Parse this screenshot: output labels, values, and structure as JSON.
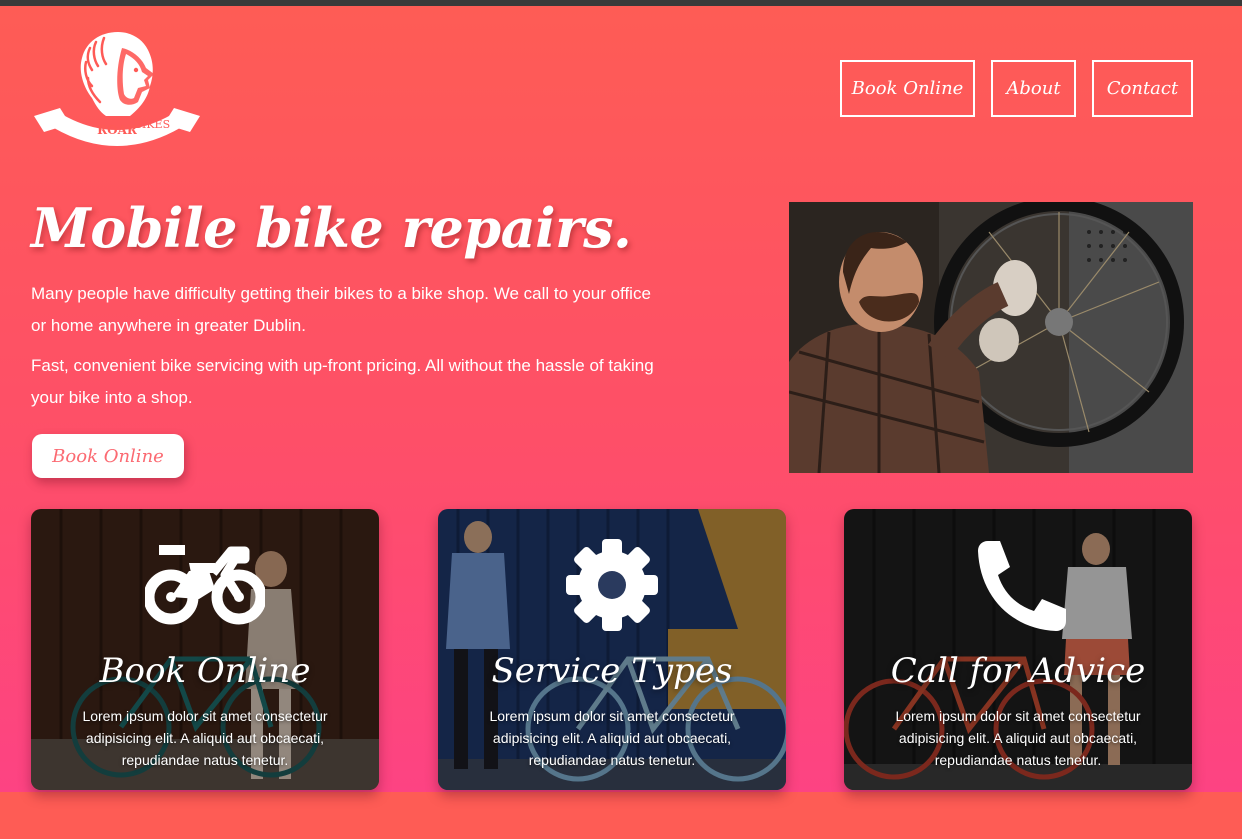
{
  "logo": {
    "line1": "ROAR",
    "line2": "BIKES"
  },
  "nav": [
    {
      "label": "Book Online"
    },
    {
      "label": "About"
    },
    {
      "label": "Contact"
    }
  ],
  "hero": {
    "title": "Mobile bike repairs.",
    "paragraph1": "Many people have difficulty getting their bikes to a bike shop. We call to your office or home anywhere in greater Dublin.",
    "paragraph2": "Fast, convenient bike servicing with up-front pricing. All without the hassle of taking your bike into a shop.",
    "cta_label": "Book Online",
    "photo_icon": "mechanic-photo"
  },
  "cards": [
    {
      "title": "Book Online",
      "text": "Lorem ipsum dolor sit amet consectetur adipisicing elit. A aliquid aut obcaecati, repudiandae natus tenetur.",
      "icon": "motorbike-icon"
    },
    {
      "title": "Service Types",
      "text": "Lorem ipsum dolor sit amet consectetur adipisicing elit. A aliquid aut obcaecati, repudiandae natus tenetur.",
      "icon": "gear-icon"
    },
    {
      "title": "Call for Advice",
      "text": "Lorem ipsum dolor sit amet consectetur adipisicing elit. A aliquid aut obcaecati, repudiandae natus tenetur.",
      "icon": "phone-icon"
    }
  ],
  "colors": {
    "background_top": "#fe5c55",
    "background_bottom": "#fd4383",
    "cta_text": "#fb6a72",
    "white": "#ffffff"
  }
}
